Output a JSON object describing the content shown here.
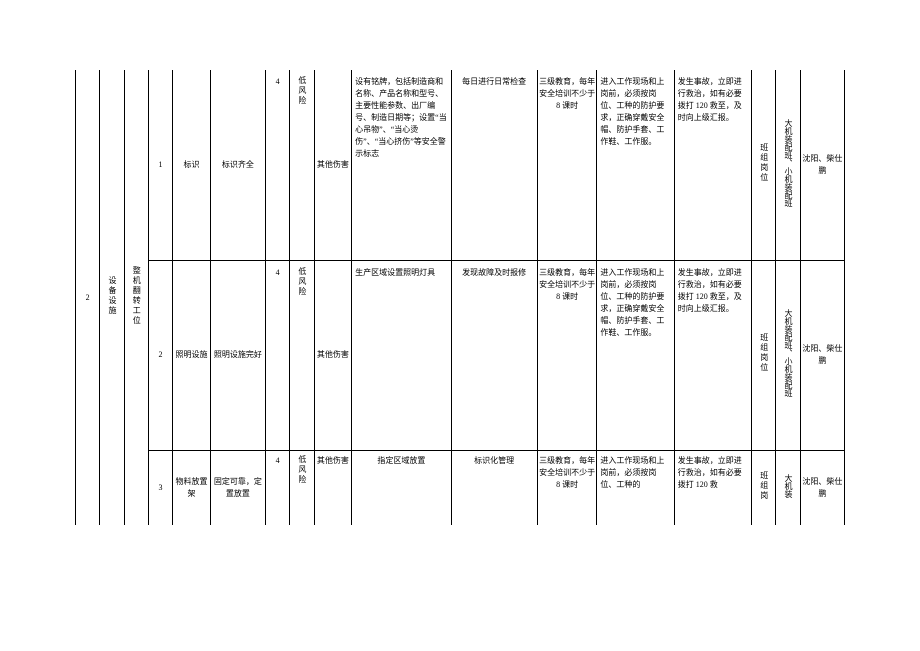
{
  "col1": "2",
  "col2": "设备设施",
  "col3": "整机翻转工位",
  "rows": [
    {
      "idx": "1",
      "item": "标识",
      "req": "标识齐全",
      "scoreA": "4",
      "risk": "低风险",
      "hazard": "其他伤害",
      "measure": "设有铭牌，包括制造商和名称、产品名称和型号、主要性能参数、出厂编号、制造日期等；设置“当心吊物”、“当心烫伤”、“当心挤伤”等安全警示标志",
      "check": "每日进行日常检查",
      "train": "三级教育，每年安全培训不少于 8 课时",
      "protect": "进入工作现场和上岗前，必须按岗位、工种的防护要求，正确穿戴安全帽、防护手套、工作鞋、工作服。",
      "emergency": "发生事故，立即进行救治，如有必要拨打 120 救至，及时向上级汇报。",
      "post": "班组岗位",
      "dept": "大机装配班、小机装配班",
      "person": "沈阳、柴仕鹏"
    },
    {
      "idx": "2",
      "item": "照明设施",
      "req": "照明设施完好",
      "scoreA": "4",
      "risk": "低风险",
      "hazard": "其他伤害",
      "measure": "生产区域设置照明灯具",
      "check": "发现故障及时报修",
      "train": "三级教育，每年安全培训不少于 8 课时",
      "protect": "进入工作现场和上岗前，必须按岗位、工种的防护要求，正确穿戴安全帽、防护手套、工作鞋、工作服。",
      "emergency": "发生事故，立即进行救治，如有必要拨打 120 救至，及时向上级汇报。",
      "post": "班组岗位",
      "dept": "大机装配班、小机装配班",
      "person": "沈阳、柴仕鹏"
    },
    {
      "idx": "3",
      "item": "物料放置架",
      "req": "固定可靠，定置放置",
      "scoreA": "4",
      "risk": "低风险",
      "hazard": "其他伤害",
      "measure": "指定区域放置",
      "check": "标识化管理",
      "train": "三级教育，每年安全培训不少于 8 课时",
      "protect": "进入工作现场和上岗前，必须按岗位、工种的",
      "emergency": "发生事故，立即进行救治，如有必要拨打 120 救",
      "post": "班组岗",
      "dept": "大机装",
      "person": "沈阳、柴仕鹏"
    }
  ]
}
